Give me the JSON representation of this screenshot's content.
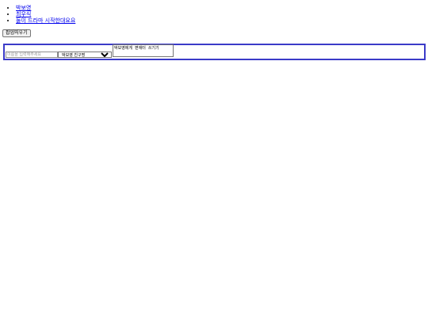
{
  "links": [
    {
      "label": "박보영"
    },
    {
      "label": "최우식"
    },
    {
      "label": "둘이 드라마 시작한대요요"
    }
  ],
  "popup_button": {
    "label": "팝업띄우기"
  },
  "form": {
    "name_input": {
      "value": "",
      "placeholder": "이름을 입력해주세요"
    },
    "friend_select": {
      "selected": "박보영 친구명"
    },
    "letter_textarea": {
      "value": "박보영에게 편애터 쓰기기"
    }
  },
  "colors": {
    "form_border": "#3b3bc8",
    "link": "#0000ee"
  }
}
